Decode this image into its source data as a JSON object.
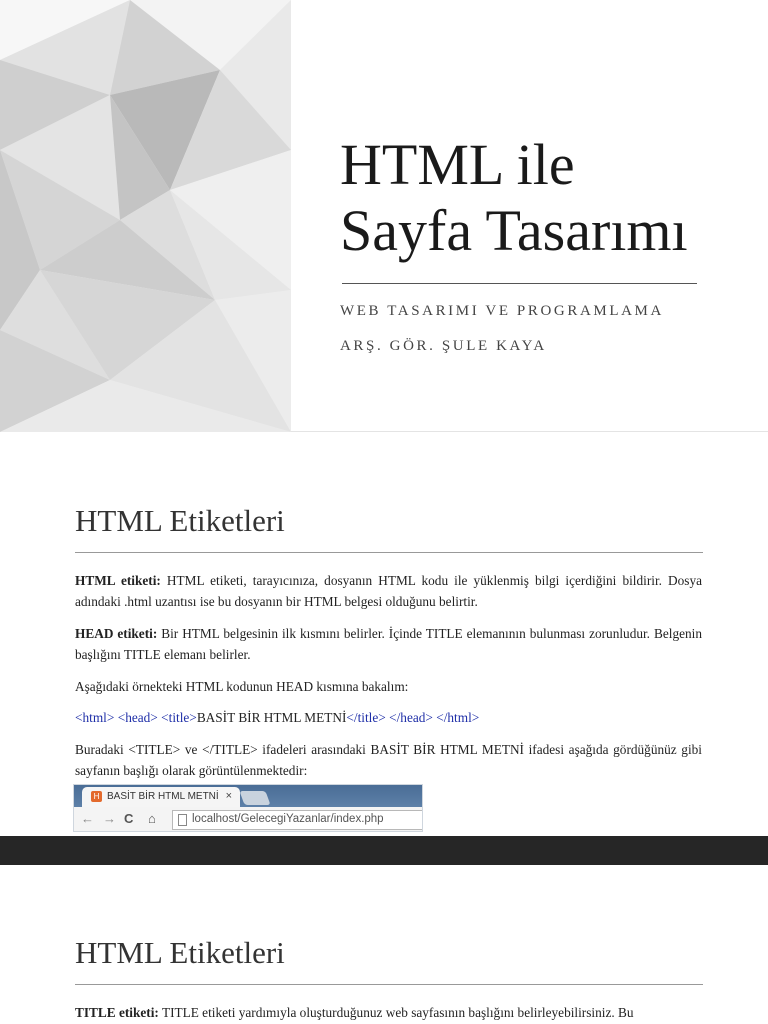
{
  "slide1": {
    "title_line1": "HTML ile",
    "title_line2": "Sayfa Tasarımı",
    "subtitle1": "WEB TASARIMI VE PROGRAMLAMA",
    "subtitle2": "ARŞ. GÖR. ŞULE KAYA"
  },
  "slide2": {
    "heading": "HTML Etiketleri",
    "p1_bold": "HTML etiketi:",
    "p1_text": " HTML etiketi, tarayıcınıza, dosyanın HTML kodu ile yüklenmiş bilgi içerdiğini bildirir. Dosya adındaki .html uzantısı ise bu dosyanın bir HTML belgesi olduğunu belirtir.",
    "p2_bold": "HEAD etiketi:",
    "p2_text": " Bir HTML belgesinin ilk kısmını belirler. İçinde TITLE elemanının bulunması zorunludur. Belgenin başlığını TITLE elemanı belirler.",
    "p3_text": "Aşağıdaki örnekteki HTML kodunun HEAD kısmına bakalım:",
    "code_open": "<html> <head> <title>",
    "code_inner": "BASİT BİR HTML METNİ",
    "code_close": "</title> </head> </html>",
    "p4_text": "Buradaki <TITLE> ve </TITLE> ifadeleri arasındaki BASİT BİR HTML METNİ ifadesi aşağıda gördüğünüz gibi sayfanın başlığı olarak görüntülenmektedir:",
    "browser": {
      "tab_title": "BASİT BİR HTML METNİ",
      "tab_close": "×",
      "favicon": "H",
      "url": "localhost/GelecegiYazanlar/index.php",
      "back_icon": "←",
      "forward_icon": "→",
      "reload_icon": "C",
      "home_icon": "⌂"
    }
  },
  "slide3": {
    "heading": "HTML Etiketleri",
    "p1_bold": "TITLE etiketi:",
    "p1_text": " TITLE etiketi yardımıyla oluşturduğunuz web sayfasının başlığını belirleyebilirsiniz. Bu"
  },
  "colors": {
    "code_blue": "#1f2fa8",
    "divider": "#262626",
    "tab_bar": "#5d80a8"
  }
}
